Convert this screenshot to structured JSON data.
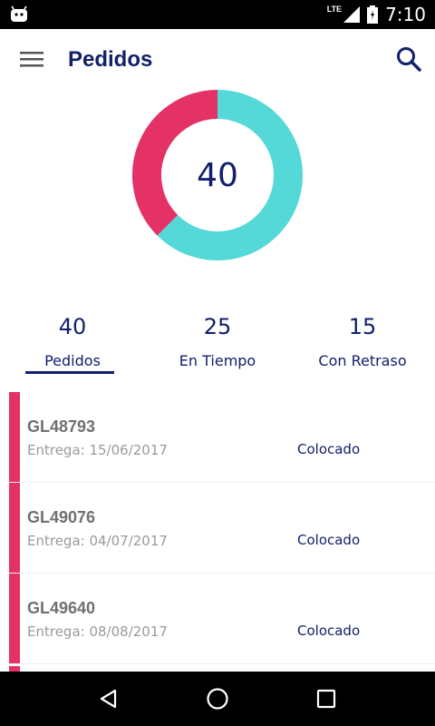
{
  "status_bar": {
    "network": "LTE",
    "time": "7:10"
  },
  "app_bar": {
    "title": "Pedidos"
  },
  "donut": {
    "total": "40",
    "segments": [
      {
        "name": "En Tiempo",
        "value": 25,
        "color": "#55d8d8"
      },
      {
        "name": "Con Retraso",
        "value": 15,
        "color": "#e43166"
      }
    ]
  },
  "tabs": [
    {
      "count": "40",
      "label": "Pedidos"
    },
    {
      "count": "25",
      "label": "En Tiempo"
    },
    {
      "count": "15",
      "label": "Con Retraso"
    }
  ],
  "orders": [
    {
      "code": "GL48793",
      "date": "Entrega: 15/06/2017",
      "status": "Colocado"
    },
    {
      "code": "GL49076",
      "date": "Entrega: 04/07/2017",
      "status": "Colocado"
    },
    {
      "code": "GL49640",
      "date": "Entrega: 08/08/2017",
      "status": "Colocado"
    }
  ],
  "colors": {
    "primary": "#12206b",
    "accent": "#e43166",
    "teal": "#55d8d8"
  },
  "icons": {
    "menu": "hamburger-icon",
    "search": "search-icon",
    "back": "back-triangle-icon",
    "home": "home-circle-icon",
    "recents": "recents-square-icon"
  }
}
